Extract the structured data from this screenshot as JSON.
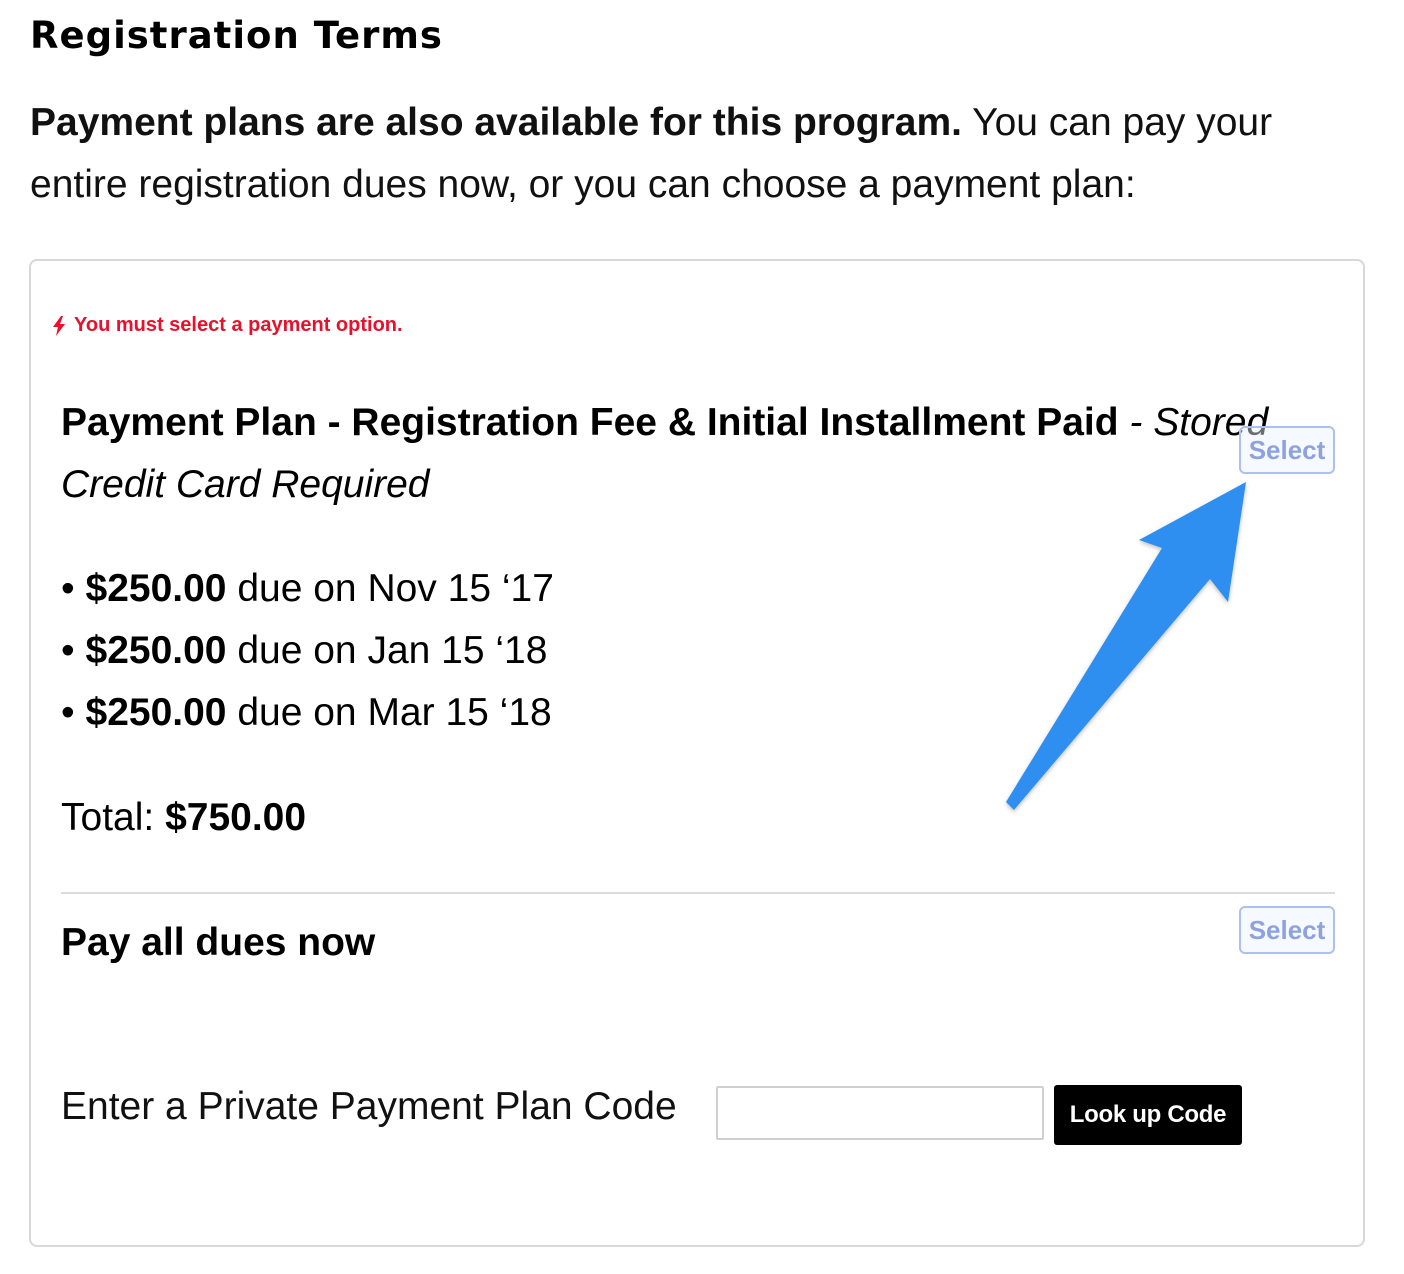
{
  "heading": "Registration Terms",
  "intro": {
    "bold": "Payment plans are also available for this program.",
    "text": " You can pay your entire registration dues now, or you can choose a payment plan:"
  },
  "error": {
    "icon": "lightning-bolt-icon",
    "text": "You must select a payment option."
  },
  "plans": [
    {
      "title": "Payment Plan - Registration Fee & Initial Installment Paid",
      "note": " - Stored Credit Card Required",
      "select_label": "Select",
      "installments": [
        {
          "amount": "$250.00",
          "text": " due on Nov 15 ‘17"
        },
        {
          "amount": "$250.00",
          "text": " due on Jan 15 ‘18"
        },
        {
          "amount": "$250.00",
          "text": " due on Mar 15 ‘18"
        }
      ],
      "total_label": "Total: ",
      "total_value": "$750.00"
    },
    {
      "title": "Pay all dues now",
      "select_label": "Select"
    }
  ],
  "private_code": {
    "label": "Enter a Private Payment Plan Code",
    "value": "",
    "button_label": "Look up Code"
  },
  "colors": {
    "error": "#e8112d",
    "select_border": "#aebff2",
    "select_text": "#8ea3de",
    "arrow": "#2e8ff0",
    "lookup_bg": "#000000"
  }
}
